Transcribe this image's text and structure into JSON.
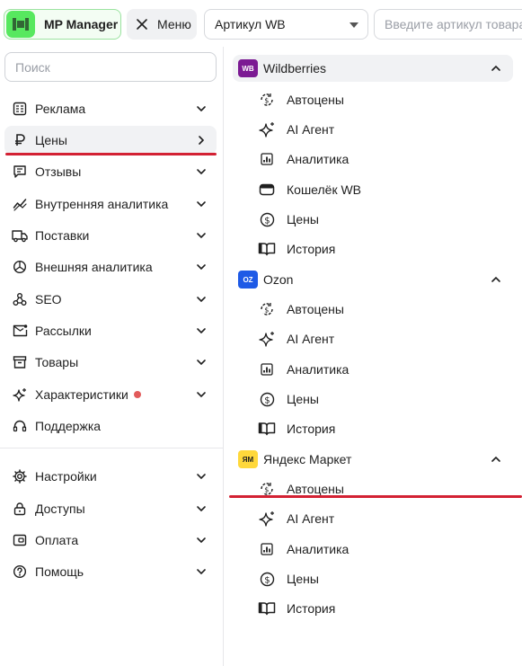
{
  "header": {
    "logo_text": "MP Manager",
    "menu_label": "Меню",
    "marketplace_select": "Артикул WB",
    "article_placeholder": "Введите артикул товара"
  },
  "sidebar": {
    "search_placeholder": "Поиск",
    "items": [
      {
        "label": "Реклама",
        "icon": "megaphone-icon",
        "chevron": "down"
      },
      {
        "label": "Цены",
        "icon": "ruble-icon",
        "chevron": "right",
        "active": true
      },
      {
        "label": "Отзывы",
        "icon": "message-icon",
        "chevron": "down"
      },
      {
        "label": "Внутренняя аналитика",
        "icon": "trend-icon",
        "chevron": "down"
      },
      {
        "label": "Поставки",
        "icon": "truck-icon",
        "chevron": "down"
      },
      {
        "label": "Внешняя аналитика",
        "icon": "pie-chart-icon",
        "chevron": "down"
      },
      {
        "label": "SEO",
        "icon": "webhook-icon",
        "chevron": "down"
      },
      {
        "label": "Рассылки",
        "icon": "mail-icon",
        "chevron": "down"
      },
      {
        "label": "Товары",
        "icon": "archive-icon",
        "chevron": "down"
      },
      {
        "label": "Характеристики",
        "icon": "sparkle-icon",
        "chevron": "down",
        "dot": true
      },
      {
        "label": "Поддержка",
        "icon": "headset-icon",
        "chevron": "none"
      }
    ],
    "bottom_items": [
      {
        "label": "Настройки",
        "icon": "gear-icon",
        "chevron": "down"
      },
      {
        "label": "Доступы",
        "icon": "lock-icon",
        "chevron": "down"
      },
      {
        "label": "Оплата",
        "icon": "wallet-icon",
        "chevron": "down"
      },
      {
        "label": "Помощь",
        "icon": "help-icon",
        "chevron": "down"
      }
    ]
  },
  "marketplaces": [
    {
      "name": "Wildberries",
      "badge": "WB",
      "badge_color": "#7c1a93",
      "items": [
        {
          "label": "Автоцены",
          "icon": "auto-price-icon"
        },
        {
          "label": "AI Агент",
          "icon": "sparkle-icon"
        },
        {
          "label": "Аналитика",
          "icon": "bar-chart-icon"
        },
        {
          "label": "Кошелёк WB",
          "icon": "wallet-icon"
        },
        {
          "label": "Цены",
          "icon": "dollar-icon"
        },
        {
          "label": "История",
          "icon": "book-icon"
        }
      ]
    },
    {
      "name": "Ozon",
      "badge": "OZ",
      "badge_color": "#1e5ae6",
      "items": [
        {
          "label": "Автоцены",
          "icon": "auto-price-icon"
        },
        {
          "label": "AI Агент",
          "icon": "sparkle-icon"
        },
        {
          "label": "Аналитика",
          "icon": "bar-chart-icon"
        },
        {
          "label": "Цены",
          "icon": "dollar-icon"
        },
        {
          "label": "История",
          "icon": "book-icon"
        }
      ]
    },
    {
      "name": "Яндекс Маркет",
      "badge": "ЯМ",
      "badge_color": "#ffd83b",
      "items": [
        {
          "label": "Автоцены",
          "icon": "auto-price-icon"
        },
        {
          "label": "AI Агент",
          "icon": "sparkle-icon"
        },
        {
          "label": "Аналитика",
          "icon": "bar-chart-icon"
        },
        {
          "label": "Цены",
          "icon": "dollar-icon"
        },
        {
          "label": "История",
          "icon": "book-icon"
        }
      ]
    }
  ],
  "colors": {
    "brand_green": "#57e85f",
    "highlight_red": "#d32133",
    "notification_dot": "#e25b5b"
  }
}
